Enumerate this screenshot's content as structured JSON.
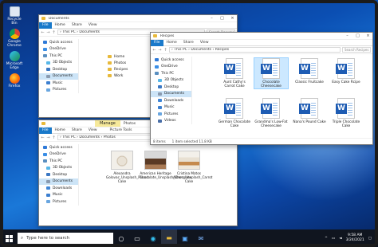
{
  "colors": {
    "accent": "#1979ca",
    "selection": "#cce8ff",
    "folder": "#e8b93a",
    "word": "#1e5cb3",
    "taskbar": "#10151f"
  },
  "desktop_icons": [
    {
      "label": "Recycle Bin",
      "icon": "recycle-bin-icon"
    },
    {
      "label": "Google Chrome",
      "icon": "chrome-icon"
    },
    {
      "label": "Microsoft Edge",
      "icon": "edge-icon"
    },
    {
      "label": "Firefox",
      "icon": "firefox-icon"
    }
  ],
  "win_documents": {
    "title": "Documents",
    "ribbon": [
      "File",
      "Home",
      "Share",
      "View"
    ],
    "path": "› This PC › Documents",
    "search": "Search Documents",
    "sidebar": [
      "Quick access",
      "OneDrive",
      "This PC",
      "3D Objects",
      "Desktop",
      "Documents",
      "Music",
      "Pictures"
    ],
    "folders": [
      "Home",
      "Photos",
      "Recipes",
      "Work"
    ]
  },
  "win_recipes": {
    "title": "Recipes",
    "ribbon": [
      "File",
      "Home",
      "Share",
      "View"
    ],
    "path": "› This PC › Documents › Recipes",
    "search": "Search Recipes",
    "sidebar": [
      "Quick access",
      "OneDrive",
      "This PC",
      "3D Objects",
      "Desktop",
      "Documents",
      "Downloads",
      "Music",
      "Pictures",
      "Videos"
    ],
    "files": [
      "Aunt Cathy's Carrot Cake",
      "Chocolate Cheesecake",
      "Classic Fruitcake",
      "Easy Cake Rcipe",
      "German Chocolate Cake",
      "Grandma's Low-Fat Cheesecake",
      "Nana's Pound Cake",
      "Triple Chocolate Cake"
    ],
    "status": {
      "count": "8 items",
      "selected": "1 item selected  11.8 KB"
    }
  },
  "win_photos": {
    "title": "Photos",
    "ribbon": [
      "File",
      "Home",
      "Share",
      "View"
    ],
    "manage_tab": "Manage",
    "picture_tools": "Picture Tools",
    "path": "› This PC › Documents › Photos",
    "sidebar": [
      "Quick access",
      "OneDrive",
      "This PC",
      "3D Objects",
      "Desktop",
      "Documents",
      "Downloads",
      "Music",
      "Pictures"
    ],
    "photos": [
      "Alexandra Golovac_Unsplash_Pound Cake",
      "American Heritage Chocolate_Unsplash_Chocolate",
      "Cristina Matos Albers_Unsplash_Carrot Cake"
    ]
  },
  "taskbar": {
    "search_placeholder": "Type here to search",
    "time": "9:58 AM",
    "date": "3/24/2021"
  }
}
